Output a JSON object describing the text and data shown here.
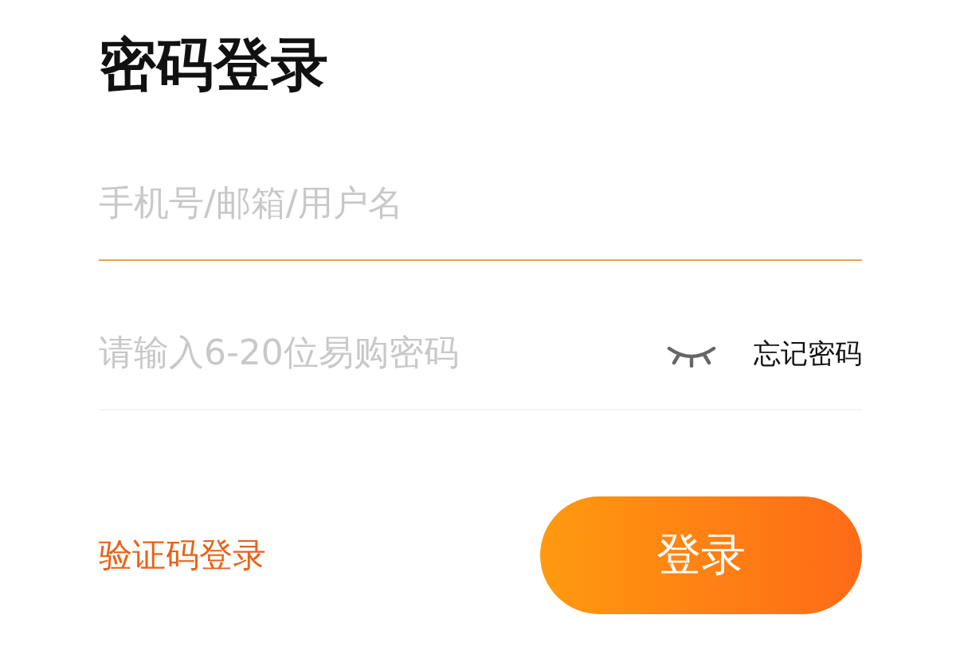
{
  "title": "密码登录",
  "fields": [
    {
      "kind": "account",
      "placeholder": "手机号/邮箱/用户名",
      "focused": true
    },
    {
      "kind": "password",
      "placeholder": "请输入6-20位易购密码",
      "focused": false
    }
  ],
  "forgot_link": "忘记密码",
  "sms_login_link": "验证码登录",
  "login_button": "登录"
}
